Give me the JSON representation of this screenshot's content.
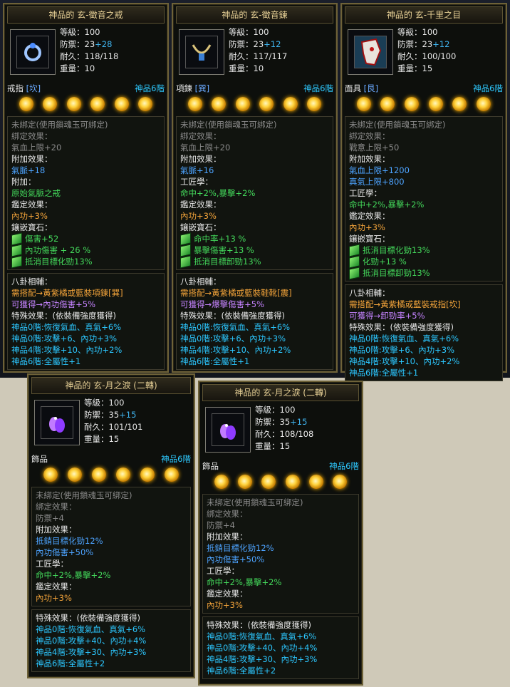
{
  "cards": [
    {
      "title": "神品的 玄-徵音之戒",
      "icon_name": "ring-icon",
      "stats": {
        "level": "等級：100",
        "def_label": "防禦：23",
        "def_bonus": "+28",
        "dur": "耐久：118/118",
        "weight": "重量：10"
      },
      "slot_name": "戒指",
      "slot_tag": "[坎]",
      "tier": "神品6階",
      "bind": [
        "未綁定(使用鎖魂玉可綁定)",
        "綁定效果：",
        "氣血上限+20"
      ],
      "add_label": "附加效果：",
      "add_lines": [
        "氣脈+18"
      ],
      "extra_label": "附加：",
      "extra_lines": [
        "原始氣脈之戒"
      ],
      "ident_label": "鑑定效果：",
      "ident_lines": [
        "內功+3%"
      ],
      "gem_label": "鑲嵌寶石：",
      "gems": [
        "傷害+52",
        "內功傷害 + 26 %",
        "抵消目標化勁13%"
      ],
      "bagua_label": "八卦相輔：",
      "bagua_need": "需搭配→黃紫橘或藍裝項鍊[巽]",
      "bagua_get": "可獲得→內功傷害+5%",
      "special_label": "特殊效果：(依裝備強度獲得)",
      "special_lines": [
        "神品0階:恢復氣血、真氣+6%",
        "神品0階:攻擊+6、內功+3%",
        "神品4階:攻擊+10、內功+2%",
        "神品6階:全屬性+1"
      ]
    },
    {
      "title": "神品的 玄-徵音鍊",
      "icon_name": "necklace-icon",
      "stats": {
        "level": "等級：100",
        "def_label": "防禦：23",
        "def_bonus": "+12",
        "dur": "耐久：117/117",
        "weight": "重量：10"
      },
      "slot_name": "項鍊",
      "slot_tag": "[巽]",
      "tier": "神品6階",
      "bind": [
        "未綁定(使用鎖魂玉可綁定)",
        "綁定效果：",
        "氣血上限+20"
      ],
      "add_label": "附加效果：",
      "add_lines": [
        "氣脈+16"
      ],
      "craft_label": "工匠學：",
      "craft_lines": [
        "命中+2%,暴擊+2%"
      ],
      "ident_label": "鑑定效果：",
      "ident_lines": [
        "內功+3%"
      ],
      "gem_label": "鑲嵌寶石：",
      "gems": [
        "命中率+13 %",
        "暴擊傷害+13 %",
        "抵消目標卸勁13%"
      ],
      "bagua_label": "八卦相輔：",
      "bagua_need": "需搭配→黃紫橘或藍裝鞋靴[震]",
      "bagua_get": "可獲得→爆擊傷害+5%",
      "special_label": "特殊效果：(依裝備強度獲得)",
      "special_lines": [
        "神品0階:恢復氣血、真氣+6%",
        "神品0階:攻擊+6、內功+3%",
        "神品4階:攻擊+10、內功+2%",
        "神品6階:全屬性+1"
      ]
    },
    {
      "title": "神品的 玄-千里之目",
      "icon_name": "mask-icon",
      "stats": {
        "level": "等級：100",
        "def_label": "防禦：23",
        "def_bonus": "+12",
        "dur": "耐久：100/100",
        "weight": "重量：15"
      },
      "slot_name": "面具",
      "slot_tag": "[艮]",
      "tier": "神品6階",
      "bind": [
        "未綁定(使用鎖魂玉可綁定)",
        "綁定效果：",
        "戰意上限+50"
      ],
      "add_label": "附加效果：",
      "add_lines": [
        "氣血上限+1200",
        "真氣上限+800"
      ],
      "craft_label": "工匠學：",
      "craft_lines": [
        "命中+2%,暴擊+2%"
      ],
      "ident_label": "鑑定效果：",
      "ident_lines": [
        "內功+3%"
      ],
      "gem_label": "鑲嵌寶石：",
      "gems": [
        "抵消目標化勁13%",
        "化勁+13 %",
        "抵消目標卸勁13%"
      ],
      "bagua_label": "八卦相輔：",
      "bagua_need": "需搭配→黃紫橘或藍裝戒指[坎]",
      "bagua_get": "可獲得→卸勁率+5%",
      "special_label": "特殊效果：(依裝備強度獲得)",
      "special_lines": [
        "神品0階:恢復氣血、真氣+6%",
        "神品0階:攻擊+6、內功+3%",
        "神品4階:攻擊+10、內功+2%",
        "神品6階:全屬性+1"
      ]
    },
    {
      "title": "神品的 玄-月之淚 (二轉)",
      "icon_name": "earring-icon",
      "stats": {
        "level": "等級：100",
        "def_label": "防禦：35",
        "def_bonus": "+15",
        "dur": "耐久：101/101",
        "weight": "重量：15"
      },
      "slot_name": "飾品",
      "slot_tag": "",
      "tier": "神品6階",
      "bind": [
        "未綁定(使用鎖魂玉可綁定)",
        "綁定效果：",
        "防禦+4"
      ],
      "add_label": "附加效果：",
      "add_lines": [
        "抵銷目標化勁12%",
        "內功傷害+50%"
      ],
      "craft_label": "工匠學：",
      "craft_lines": [
        "命中+2%,暴擊+2%"
      ],
      "ident_label": "鑑定效果：",
      "ident_lines": [
        "內功+3%"
      ],
      "special_label": "特殊效果：(依裝備強度獲得)",
      "special_lines": [
        "神品0階:恢復氣血、真氣+6%",
        "神品0階:攻擊+40、內功+4%",
        "神品4階:攻擊+30、內功+3%",
        "神品6階:全屬性+2"
      ]
    },
    {
      "title": "神品的 玄-月之淚 (二轉)",
      "icon_name": "earring-icon",
      "stats": {
        "level": "等級：100",
        "def_label": "防禦：35",
        "def_bonus": "+15",
        "dur": "耐久：108/108",
        "weight": "重量：15"
      },
      "slot_name": "飾品",
      "slot_tag": "",
      "tier": "神品6階",
      "bind": [
        "未綁定(使用鎖魂玉可綁定)",
        "綁定效果：",
        "防禦+4"
      ],
      "add_label": "附加效果：",
      "add_lines": [
        "抵銷目標化勁12%",
        "內功傷害+50%"
      ],
      "craft_label": "工匠學：",
      "craft_lines": [
        "命中+2%,暴擊+2%"
      ],
      "ident_label": "鑑定效果：",
      "ident_lines": [
        "內功+3%"
      ],
      "special_label": "特殊效果：(依裝備強度獲得)",
      "special_lines": [
        "神品0階:恢復氣血、真氣+6%",
        "神品0階:攻擊+40、內功+4%",
        "神品4階:攻擊+30、內功+3%",
        "神品6階:全屬性+2"
      ]
    }
  ]
}
